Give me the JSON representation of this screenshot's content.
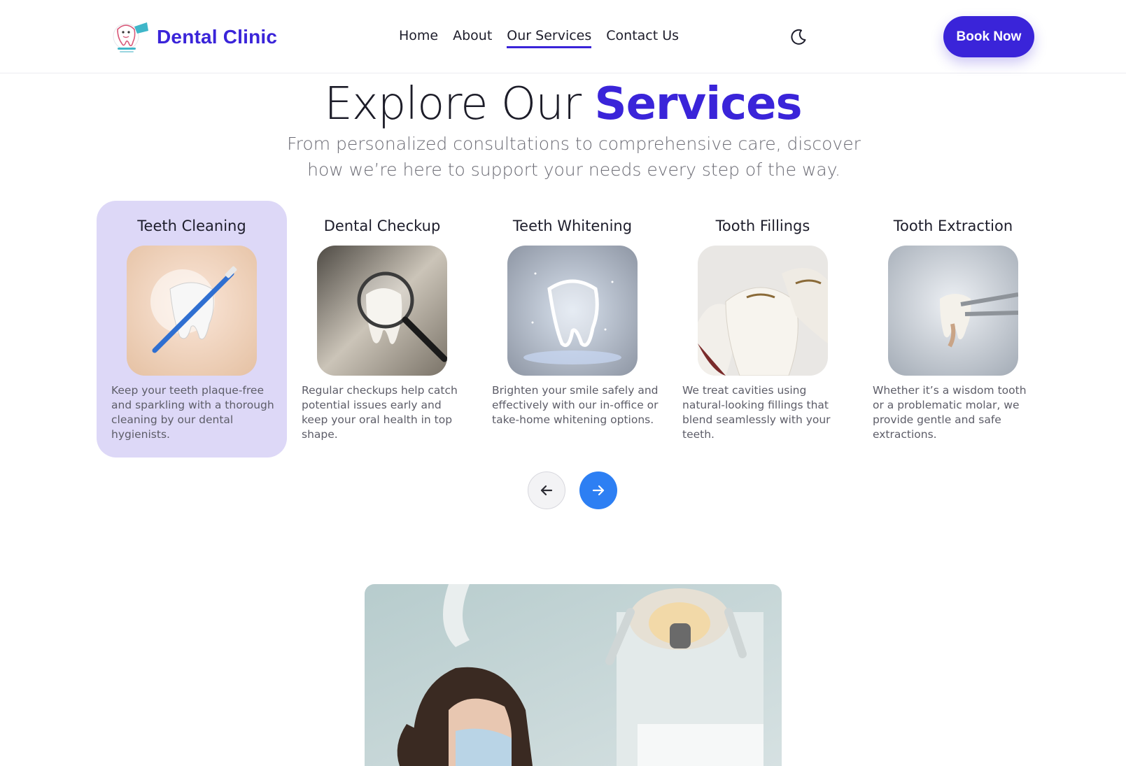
{
  "header": {
    "brand_name": "Dental Clinic",
    "nav": [
      {
        "label": "Home",
        "active": false
      },
      {
        "label": "About",
        "active": false
      },
      {
        "label": "Our Services",
        "active": true
      },
      {
        "label": "Contact Us",
        "active": false
      }
    ],
    "theme_toggle_icon": "moon-icon",
    "book_label": "Book Now"
  },
  "hero": {
    "title_plain": "Explore Our ",
    "title_accent": "Services",
    "subtitle": "From personalized consultations to comprehensive care, discover how we’re here to support your needs every step of the way."
  },
  "services": [
    {
      "title": "Teeth Cleaning",
      "desc": "Keep your teeth plaque-free and sparkling with a thorough cleaning by our dental hygienists.",
      "image": "tooth-with-toothbrush",
      "active": true
    },
    {
      "title": "Dental Checkup",
      "desc": "Regular checkups help catch potential issues early and keep your oral health in top shape.",
      "image": "tooth-with-magnifier",
      "active": false
    },
    {
      "title": "Teeth Whitening",
      "desc": "Brighten your smile safely and effectively with our in-office or take-home whitening options.",
      "image": "glowing-tooth",
      "active": false
    },
    {
      "title": "Tooth Fillings",
      "desc": "We treat cavities using natural-looking fillings that blend seamlessly with your teeth.",
      "image": "filled-molars",
      "active": false
    },
    {
      "title": "Tooth Extraction",
      "desc": "Whether it’s a wisdom tooth or a problematic molar, we provide gentle and safe extractions.",
      "image": "tooth-in-forceps",
      "active": false
    }
  ],
  "pager": {
    "prev_icon": "arrow-left-icon",
    "next_icon": "arrow-right-icon"
  },
  "colors": {
    "accent": "#3a24d9",
    "card_active_bg": "#ddd8f7",
    "pager_next": "#2d7ff3"
  },
  "feature_image": "dentist-at-work-photo"
}
